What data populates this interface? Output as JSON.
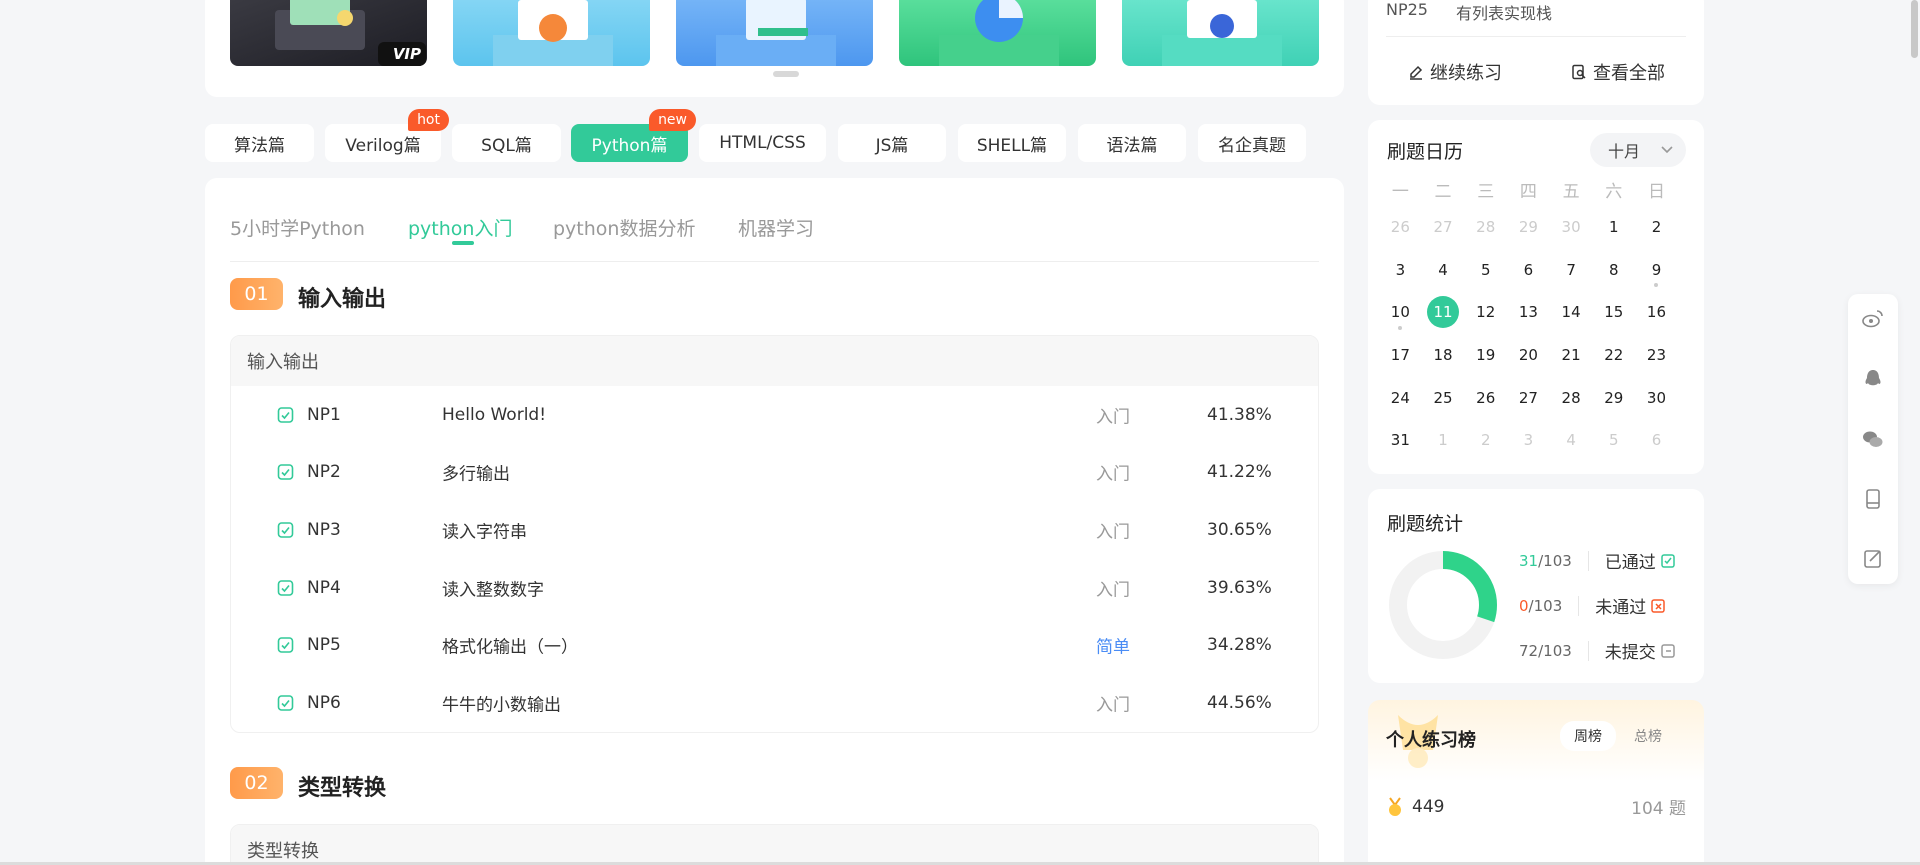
{
  "colors": {
    "accent": "#32ca99",
    "badge": "#fa5a2a",
    "orange": "#ff9a4a",
    "easy": "#4a8cf5",
    "fail": "#fa5a2a"
  },
  "banner_vip": "VIP",
  "categories": [
    {
      "label": "算法篇"
    },
    {
      "label": "Verilog篇",
      "badge": "hot"
    },
    {
      "label": "SQL篇"
    },
    {
      "label": "Python篇",
      "badge": "new",
      "active": true
    },
    {
      "label": "HTML/CSS"
    },
    {
      "label": "JS篇"
    },
    {
      "label": "SHELL篇"
    },
    {
      "label": "语法篇"
    },
    {
      "label": "名企真题"
    }
  ],
  "sub_tabs": [
    {
      "label": "5小时学Python"
    },
    {
      "label": "python入门",
      "active": true
    },
    {
      "label": "python数据分析"
    },
    {
      "label": "机器学习"
    }
  ],
  "sections": [
    {
      "num": "01",
      "title": "输入输出",
      "group": "输入输出",
      "questions": [
        {
          "id": "NP1",
          "title": "Hello World!",
          "difficulty": "入门",
          "rate": "41.38%"
        },
        {
          "id": "NP2",
          "title": "多行输出",
          "difficulty": "入门",
          "rate": "41.22%"
        },
        {
          "id": "NP3",
          "title": "读入字符串",
          "difficulty": "入门",
          "rate": "30.65%"
        },
        {
          "id": "NP4",
          "title": "读入整数数字",
          "difficulty": "入门",
          "rate": "39.63%"
        },
        {
          "id": "NP5",
          "title": "格式化输出（一）",
          "difficulty": "简单",
          "rate": "34.28%"
        },
        {
          "id": "NP6",
          "title": "牛牛的小数输出",
          "difficulty": "入门",
          "rate": "44.56%"
        }
      ]
    },
    {
      "num": "02",
      "title": "类型转换",
      "group": "类型转换",
      "questions": []
    }
  ],
  "practice": {
    "last_id": "NP25",
    "last_title": "有列表实现栈",
    "continue_label": "继续练习",
    "view_all_label": "查看全部"
  },
  "calendar": {
    "title": "刷题日历",
    "month": "十月",
    "weekdays": [
      "一",
      "二",
      "三",
      "四",
      "五",
      "六",
      "日"
    ],
    "days": [
      {
        "d": "26",
        "out": true
      },
      {
        "d": "27",
        "out": true
      },
      {
        "d": "28",
        "out": true
      },
      {
        "d": "29",
        "out": true
      },
      {
        "d": "30",
        "out": true
      },
      {
        "d": "1"
      },
      {
        "d": "2"
      },
      {
        "d": "3"
      },
      {
        "d": "4"
      },
      {
        "d": "5"
      },
      {
        "d": "6"
      },
      {
        "d": "7"
      },
      {
        "d": "8"
      },
      {
        "d": "9",
        "dot": true
      },
      {
        "d": "10",
        "dot": true
      },
      {
        "d": "11",
        "today": true
      },
      {
        "d": "12"
      },
      {
        "d": "13"
      },
      {
        "d": "14"
      },
      {
        "d": "15"
      },
      {
        "d": "16"
      },
      {
        "d": "17"
      },
      {
        "d": "18"
      },
      {
        "d": "19"
      },
      {
        "d": "20"
      },
      {
        "d": "21"
      },
      {
        "d": "22"
      },
      {
        "d": "23"
      },
      {
        "d": "24"
      },
      {
        "d": "25"
      },
      {
        "d": "26"
      },
      {
        "d": "27"
      },
      {
        "d": "28"
      },
      {
        "d": "29"
      },
      {
        "d": "30"
      },
      {
        "d": "31"
      },
      {
        "d": "1",
        "out": true
      },
      {
        "d": "2",
        "out": true
      },
      {
        "d": "3",
        "out": true
      },
      {
        "d": "4",
        "out": true
      },
      {
        "d": "5",
        "out": true
      },
      {
        "d": "6",
        "out": true
      }
    ]
  },
  "stats": {
    "title": "刷题统计",
    "total": "103",
    "passed": {
      "value": "31",
      "label": "已通过"
    },
    "failed": {
      "value": "0",
      "label": "未通过"
    },
    "unsubmitted": {
      "value": "72",
      "label": "未提交"
    },
    "progress_fraction": 0.301
  },
  "rank": {
    "title": "个人练习榜",
    "tab_week": "周榜",
    "tab_total": "总榜",
    "user_score": "449",
    "user_count": "104 题"
  }
}
